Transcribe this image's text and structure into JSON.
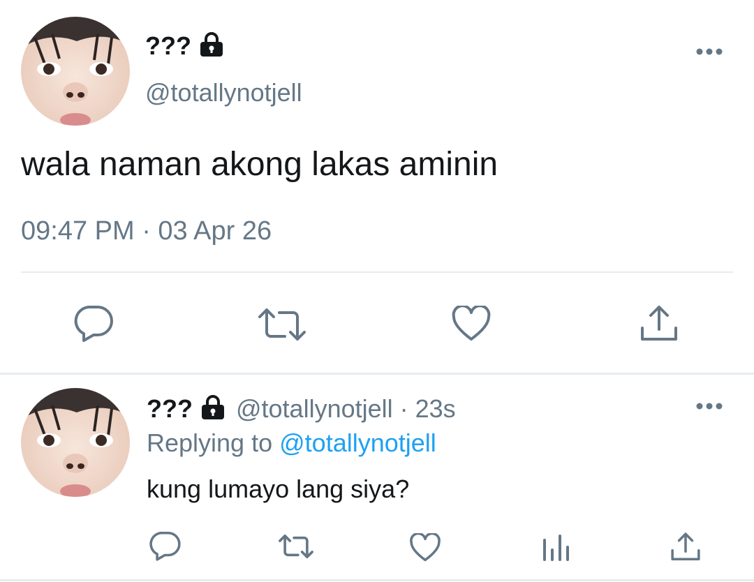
{
  "main_tweet": {
    "display_name": "???",
    "handle": "@totallynotjell",
    "text": "wala naman akong lakas aminin",
    "timestamp": "09:47 PM · 03 Apr 26",
    "protected_icon": "lock-icon",
    "actions": [
      "reply-icon",
      "retweet-icon",
      "like-icon",
      "share-icon"
    ]
  },
  "reply_tweet": {
    "display_name": "???",
    "handle": "@totallynotjell",
    "separator": "·",
    "age": "23s",
    "replying_to_label": "Replying to",
    "replying_to_handle": "@totallynotjell",
    "text": "kung lumayo lang siya?",
    "protected_icon": "lock-icon",
    "actions": [
      "reply-icon",
      "retweet-icon",
      "like-icon",
      "analytics-icon",
      "share-icon"
    ]
  },
  "colors": {
    "text": "#14171a",
    "secondary": "#657786",
    "link": "#1da1f2",
    "divider": "#e6ecf0"
  }
}
